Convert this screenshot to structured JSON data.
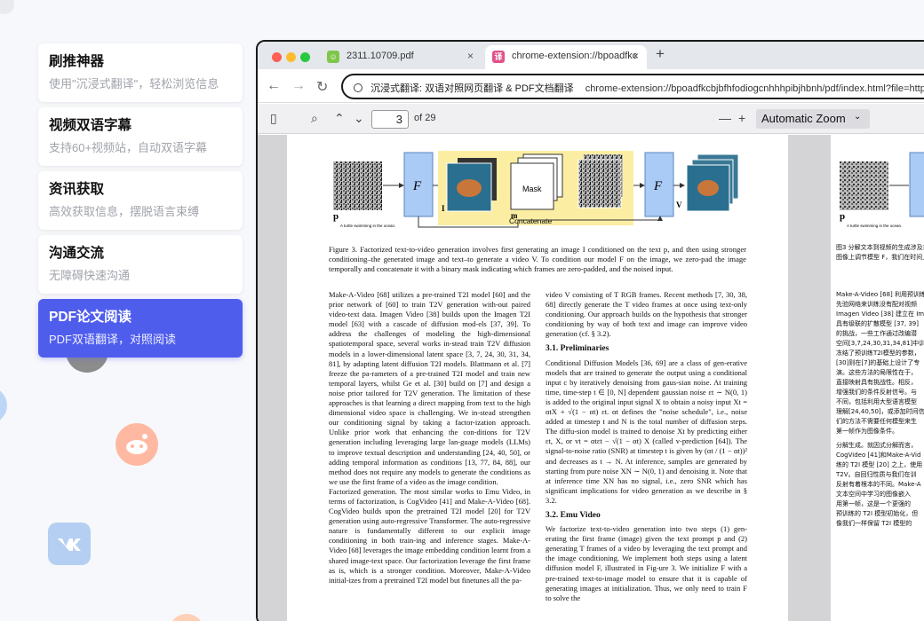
{
  "cards": [
    {
      "title": "刷推神器",
      "desc": "使用\"沉浸式翻译\"，轻松浏览信息"
    },
    {
      "title": "视频双语字幕",
      "desc": "支持60+视频站，自动双语字幕"
    },
    {
      "title": "资讯获取",
      "desc": "高效获取信息，摆脱语言束缚"
    },
    {
      "title": "沟通交流",
      "desc": "无障碍快速沟通"
    },
    {
      "title": "PDF论文阅读",
      "desc": "PDF双语翻译，对照阅读"
    }
  ],
  "browser": {
    "tabs": [
      {
        "label": "2311.10709.pdf",
        "close": "×"
      },
      {
        "label": "chrome-extension://bpoadfkc",
        "close": "×"
      }
    ],
    "new_tab": "+",
    "address": {
      "site_label": "沉浸式翻译: 双语对照网页翻译 & PDF文档翻译",
      "url": "chrome-extension://bpoadfkcbjbfhfodiogcnhhhpibjhbnh/pdf/index.html?file=https%"
    }
  },
  "pdf_toolbar": {
    "page_number": "3",
    "page_count": "of 29",
    "zoom_out": "—",
    "zoom_in": "+",
    "zoom_level": "Automatic Zoom"
  },
  "figure": {
    "mask": "Mask",
    "concatenate": "Concatenate",
    "f_symbol": "F",
    "p_label": "p",
    "p_text": "A turtle swimming in the ocean.",
    "i_label": "I",
    "m_label": "m",
    "v_label": "V"
  },
  "figure2": {
    "p_label": "p",
    "p_text": "A turtle swimming in the ocean."
  },
  "caption": "Figure 3. Factorized text-to-video generation involves first generating an image I conditioned on the text p, and then using stronger conditioning–the generated image and text–to generate a video V. To condition our model F on the image, we zero-pad the image temporally and concatenate it with a binary mask indicating which frames are zero-padded, and the noised input.",
  "col_left": [
    "Make-A-Video [68] utilizes a pre-trained T2I model [60] and the prior network of [60] to train T2V generation with-out paired video-text data. Imagen Video [38] builds upon the Imagen T2I model [63] with a cascade of diffusion mod-els [37, 39]. To address the challenges of modeling the high-dimensional spatiotemporal space, several works in-stead train T2V diffusion models in a lower-dimensional latent space [3, 7, 24, 30, 31, 34, 81], by adapting latent diffusion T2I models. Blattmann et al. [7] freeze the pa-rameters of a pre-trained T2I model and train new temporal layers, whilst Ge et al. [30] build on [7] and design a noise prior tailored for T2V generation. The limitation of these approaches is that learning a direct mapping from text to the high dimensional video space is challenging. We in-stead strengthen our conditioning signal by taking a factor-ization approach. Unlike prior work that enhancing the con-ditions for T2V generation including leveraging large lan-guage models (LLMs) to improve textual description and understanding [24, 40, 50], or adding temporal information as conditions [13, 77, 84, 88], our method does not require any models to generate the conditions as we use the first frame of a video as the image condition.",
    "Factorized generation. The most similar works to Emu Video, in terms of factorization, is CogVideo [41] and Make-A-Video [68]. CogVideo builds upon the pretrained T2I model [20] for T2V generation using auto-regressive Transformer. The auto-regressive nature is fundamentally different to our explicit image conditioning in both train-ing and inference stages. Make-A-Video [68] leverages the image embedding condition learnt from a shared image-text space. Our factorization leverage the first frame as is, which is a stronger condition. Moreover, Make-A-Video initial-izes from a pretrained T2I model but finetunes all the pa-"
  ],
  "col_right": {
    "intro": "video V consisting of T RGB frames. Recent methods [7, 30, 38, 68] directly generate the T video frames at once using text-only conditioning. Our approach builds on the hypothesis that stronger conditioning by way of both text and image can improve video generation (cf. § 3.2).",
    "h1": "3.1. Preliminaries",
    "p1": "Conditional Diffusion Models [36, 69] are a class of gen-erative models that are trained to generate the output using a conditional input c by iteratively denoising from gaus-sian noise. At training time, time-step t ∈ [0, N] dependent gaussian noise εt ∼ N(0, 1) is added to the original input signal X to obtain a noisy input Xt = αtX + √(1 − αt) εt. αt defines the \"noise schedule\", i.e., noise added at timestep t and N is the total number of diffusion steps. The diffu-sion model is trained to denoise Xt by predicting either εt, X, or vt = αtεt − √(1 − αt) X (called v-prediction [64]). The signal-to-noise ratio (SNR) at timestep t is given by (αt / (1 − αt))² and decreases as t → N. At inference, samples are generated by starting from pure noise XN ∼ N(0, 1) and denoising it. Note that at inference time XN has no signal, i.e., zero SNR which has significant implications for video generation as we describe in § 3.2.",
    "h2": "3.2. Emu Video",
    "p2": "We factorize text-to-video generation into two steps (1) gen-erating the first frame (image) given the text prompt p and (2) generating T frames of a video by leveraging the text prompt and the image conditioning. We implement both steps using a latent diffusion model F, illustrated in Fig-ure 3. We initialize F with a pre-trained text-to-image model to ensure that it is capable of generating images at initialization. Thus, we only need to train F to solve the"
  },
  "translation": {
    "caption": [
      "图3 分解文本到视频的生成涉及首先",
      "图像上调节模型 F，我们在时间上"
    ],
    "lines": [
      "Make-A-Video [68] 利用预训练",
      "先验网络来训练没有配对视频",
      "Imagen Video [38] 建立在 Ima",
      "具有级联的扩散模型 [37, 39]",
      "的挑战，一些工作通过改编潜",
      "空间[3,7,24,30,31,34,81]中训练",
      "冻结了预训练T2I模型的参数，",
      "[30]则在[7]的基础上设计了专",
      "演。这些方法的局限性在于，",
      "直接映射具有挑战性。相反，",
      "增强我们的条件反射信号。与",
      "不同，包括利用大型语言模型",
      "理解[24,40,50]，或添加时间信",
      "们的方法不需要任何模型来生",
      "第一帧作为图像条件。",
      "分解生成。就因式分解而言，",
      "CogVideo [41]和Make-A-Vid",
      "练的 T2I 模型 [20] 之上，使用",
      "T2V。自回归性质与我们在训",
      "反射有着根本的不同。Make-A",
      "文本空间中学习的图像嵌入",
      "用第一帧，这是一个更强的",
      "预训练的 T2I 模型初始化，但",
      "像我们一样保留 T2I 模型的"
    ]
  },
  "colors": {
    "accent": "#4f5ded",
    "figure_panel": "#fbeea3",
    "model_block": "#a9cbf5",
    "link_red": "#c4262e"
  }
}
